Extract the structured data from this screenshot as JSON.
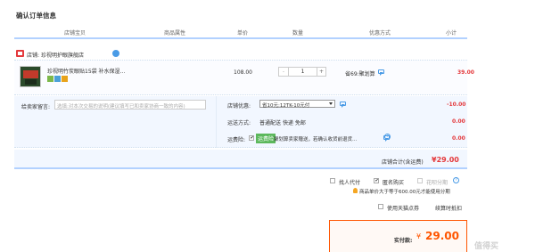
{
  "page_title": "确认订单信息",
  "table_headers": [
    "店铺宝贝",
    "商品属性",
    "单价",
    "数量",
    "优惠方式",
    "小计"
  ],
  "shop": {
    "prefix": "店铺:",
    "name": "珍视明护眼旗舰店"
  },
  "item": {
    "title": "珍视明竹炭眼贴15袋 补水保湿...",
    "price": "108.00",
    "quantity": "1",
    "minus": "-",
    "plus": "+",
    "discount": "省69:聚划算",
    "subtotal": "39.00"
  },
  "message": {
    "label": "给卖家留言:",
    "placeholder": "选填:对本次交易的说明(建议填写已和卖家协商一致的内容)"
  },
  "shop_discount": {
    "label": "店铺优惠:",
    "selected": "省10元:12TK-10元付",
    "amount": "-10.00"
  },
  "shipping": {
    "label": "运送方式:",
    "method": "普通配送",
    "fee_label": "快递 免邮",
    "amount": "0.00"
  },
  "insurance": {
    "label": "运费险:",
    "badge": "运费险",
    "text": "聚划算卖家赠送，若确认收货前退货...",
    "amount": "0.00"
  },
  "shop_total": {
    "label": "店铺合计(含运费)",
    "amount": "¥29.00"
  },
  "options": {
    "pay_for_others": "找人代付",
    "anonymous": "匿名购买",
    "installment": "花呗分期",
    "installment_note": "商品单价大于等于600.00元才能使用分期",
    "tmall_points": "使用天猫点券",
    "points_note": "续算时抵扣"
  },
  "final": {
    "label": "实付款:",
    "currency": "¥",
    "amount": "29.00"
  },
  "watermark": "值得买",
  "colors": {
    "accent": "#e4393c",
    "orange": "#ff5500",
    "blue": "#4a9be6",
    "green": "#5cb85c"
  }
}
